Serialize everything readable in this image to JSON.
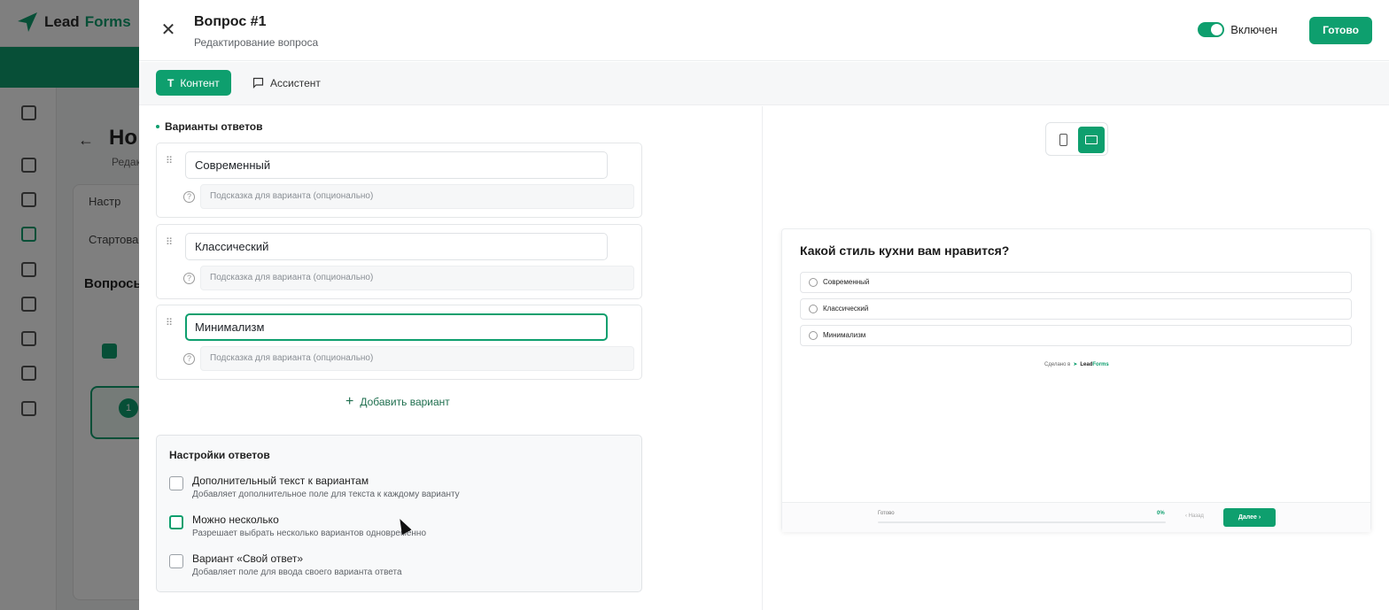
{
  "background": {
    "logo": {
      "part1": "Lead",
      "part2": "Forms"
    },
    "page_title": "Но",
    "page_subtitle": "Редак",
    "tab_settings": "Настр",
    "tab_start": "Стартова",
    "questions_label": "Вопросы",
    "question_number": "1"
  },
  "drawer": {
    "title": "Вопрос #1",
    "subtitle": "Редактирование вопроса",
    "toggle_label": "Включен",
    "done_label": "Готово",
    "tabs": [
      {
        "label": "Контент",
        "icon": "text-icon"
      },
      {
        "label": "Ассистент",
        "icon": "chat-icon"
      }
    ]
  },
  "answers": {
    "section_label": "Варианты ответов",
    "hint_placeholder": "Подсказка для варианта (опционально)",
    "options": [
      {
        "value": "Современный"
      },
      {
        "value": "Классический"
      },
      {
        "value": "Минимализм"
      }
    ],
    "add_label": "Добавить вариант"
  },
  "settings": {
    "title": "Настройки ответов",
    "rows": [
      {
        "label": "Дополнительный текст к вариантам",
        "desc": "Добавляет дополнительное поле для текста к каждому варианту",
        "checked": false
      },
      {
        "label": "Можно несколько",
        "desc": "Разрешает выбрать несколько вариантов одновременно",
        "checked": false
      },
      {
        "label": "Вариант «Свой ответ»",
        "desc": "Добавляет поле для ввода своего варианта ответа",
        "checked": false
      }
    ]
  },
  "preview": {
    "question": "Какой стиль кухни вам нравится?",
    "options": [
      "Современный",
      "Классический",
      "Минимализм"
    ],
    "made_with": "Сделано в",
    "brand1": "Lead",
    "brand2": "Forms",
    "ready_label": "Готово",
    "progress": "0%",
    "back_label": "Назад",
    "next_label": "Далее"
  },
  "colors": {
    "accent": "#0e9f6e",
    "overlay": "rgba(0,0,0,0.5)"
  }
}
